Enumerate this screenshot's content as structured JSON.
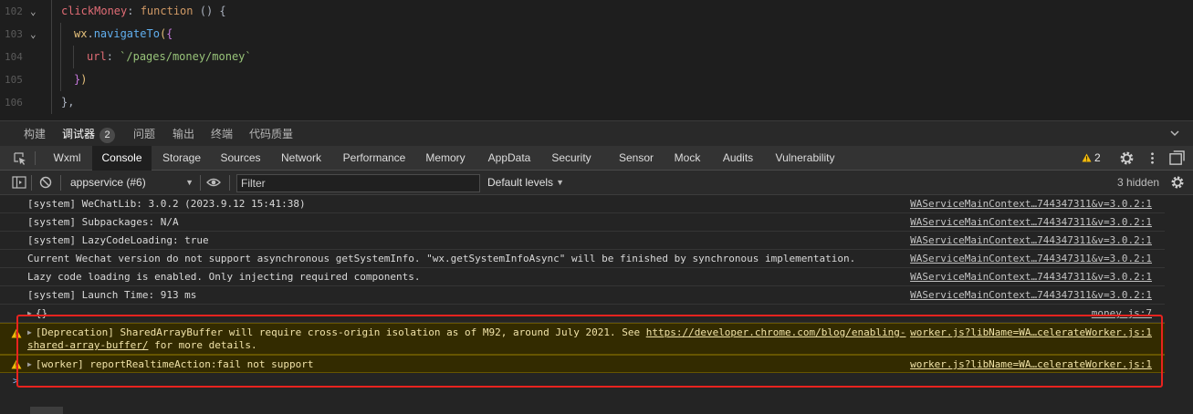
{
  "editor": {
    "lines": [
      {
        "num": "102",
        "text": "clickMoney: function () {"
      },
      {
        "num": "103",
        "text": "wx.navigateTo({"
      },
      {
        "num": "104",
        "text": "url: `/pages/money/money`"
      },
      {
        "num": "105",
        "text": "})"
      },
      {
        "num": "106",
        "text": "},"
      }
    ],
    "tokens": {
      "l102_prop": "clickMoney",
      "l102_colon": ": ",
      "l102_kw": "function",
      "l102_rest": " () {",
      "l103_obj": "wx",
      "l103_dot": ".",
      "l103_fn": "navigateTo",
      "l103_paren": "(",
      "l103_brace": "{",
      "l104_key": "url",
      "l104_colon": ": ",
      "l104_str": "`/pages/money/money`",
      "l105_brace": "}",
      "l105_paren": ")",
      "l106": "},"
    }
  },
  "panel_tabs": {
    "items": [
      {
        "label": "构建",
        "active": false
      },
      {
        "label": "调试器",
        "active": true
      },
      {
        "label": "问题",
        "active": false
      },
      {
        "label": "输出",
        "active": false
      },
      {
        "label": "终端",
        "active": false
      },
      {
        "label": "代码质量",
        "active": false
      }
    ],
    "debugger_badge": "2"
  },
  "tool_tabs": {
    "items": [
      {
        "label": "Wxml"
      },
      {
        "label": "Console"
      },
      {
        "label": "Storage"
      },
      {
        "label": "Sources"
      },
      {
        "label": "Network"
      },
      {
        "label": "Performance"
      },
      {
        "label": "Memory"
      },
      {
        "label": "AppData"
      },
      {
        "label": "Security"
      },
      {
        "label": "Sensor"
      },
      {
        "label": "Mock"
      },
      {
        "label": "Audits"
      },
      {
        "label": "Vulnerability"
      }
    ],
    "active": "Console",
    "warning_count": "2"
  },
  "console_toolbar": {
    "context": "appservice (#6)",
    "filter_placeholder": "Filter",
    "levels": "Default levels",
    "hidden": "3 hidden"
  },
  "messages": [
    {
      "text": "[system] WeChatLib: 3.0.2 (2023.9.12 15:41:38)",
      "source": "WAServiceMainContext…744347311&v=3.0.2:1",
      "level": "log"
    },
    {
      "text": "[system] Subpackages: N/A",
      "source": "WAServiceMainContext…744347311&v=3.0.2:1",
      "level": "log"
    },
    {
      "text": "[system] LazyCodeLoading: true",
      "source": "WAServiceMainContext…744347311&v=3.0.2:1",
      "level": "log"
    },
    {
      "text": "Current Wechat version do not support asynchronous getSystemInfo. \"wx.getSystemInfoAsync\" will be finished by synchronous implementation.",
      "source": "WAServiceMainContext…744347311&v=3.0.2:1",
      "level": "log"
    },
    {
      "text": "Lazy code loading is enabled. Only injecting required components.",
      "source": "WAServiceMainContext…744347311&v=3.0.2:1",
      "level": "log"
    },
    {
      "text": "[system] Launch Time: 913 ms",
      "source": "WAServiceMainContext…744347311&v=3.0.2:1",
      "level": "log"
    },
    {
      "text": "{}",
      "source": "money.js:7",
      "level": "log"
    },
    {
      "text_before": "[Deprecation] SharedArrayBuffer will require cross-origin isolation as of M92, around July 2021. See ",
      "link": "https://developer.chrome.com/blog/enabling-shared-array-buffer/",
      "text_after": " for more details.",
      "source": "worker.js?libName=WA…celerateWorker.js:1",
      "level": "warning"
    },
    {
      "text": "[worker] reportRealtimeAction:fail not support",
      "source": "worker.js?libName=WA…celerateWorker.js:1",
      "level": "warning"
    }
  ],
  "prompt": ">",
  "colors": {
    "editor_bg": "#1e1e1e",
    "panel_bg": "#242424",
    "warning_bg": "#332b00",
    "warning_text": "#f0e2a8",
    "warning_icon": "#f2b90c",
    "highlight_border": "#e8231f"
  }
}
